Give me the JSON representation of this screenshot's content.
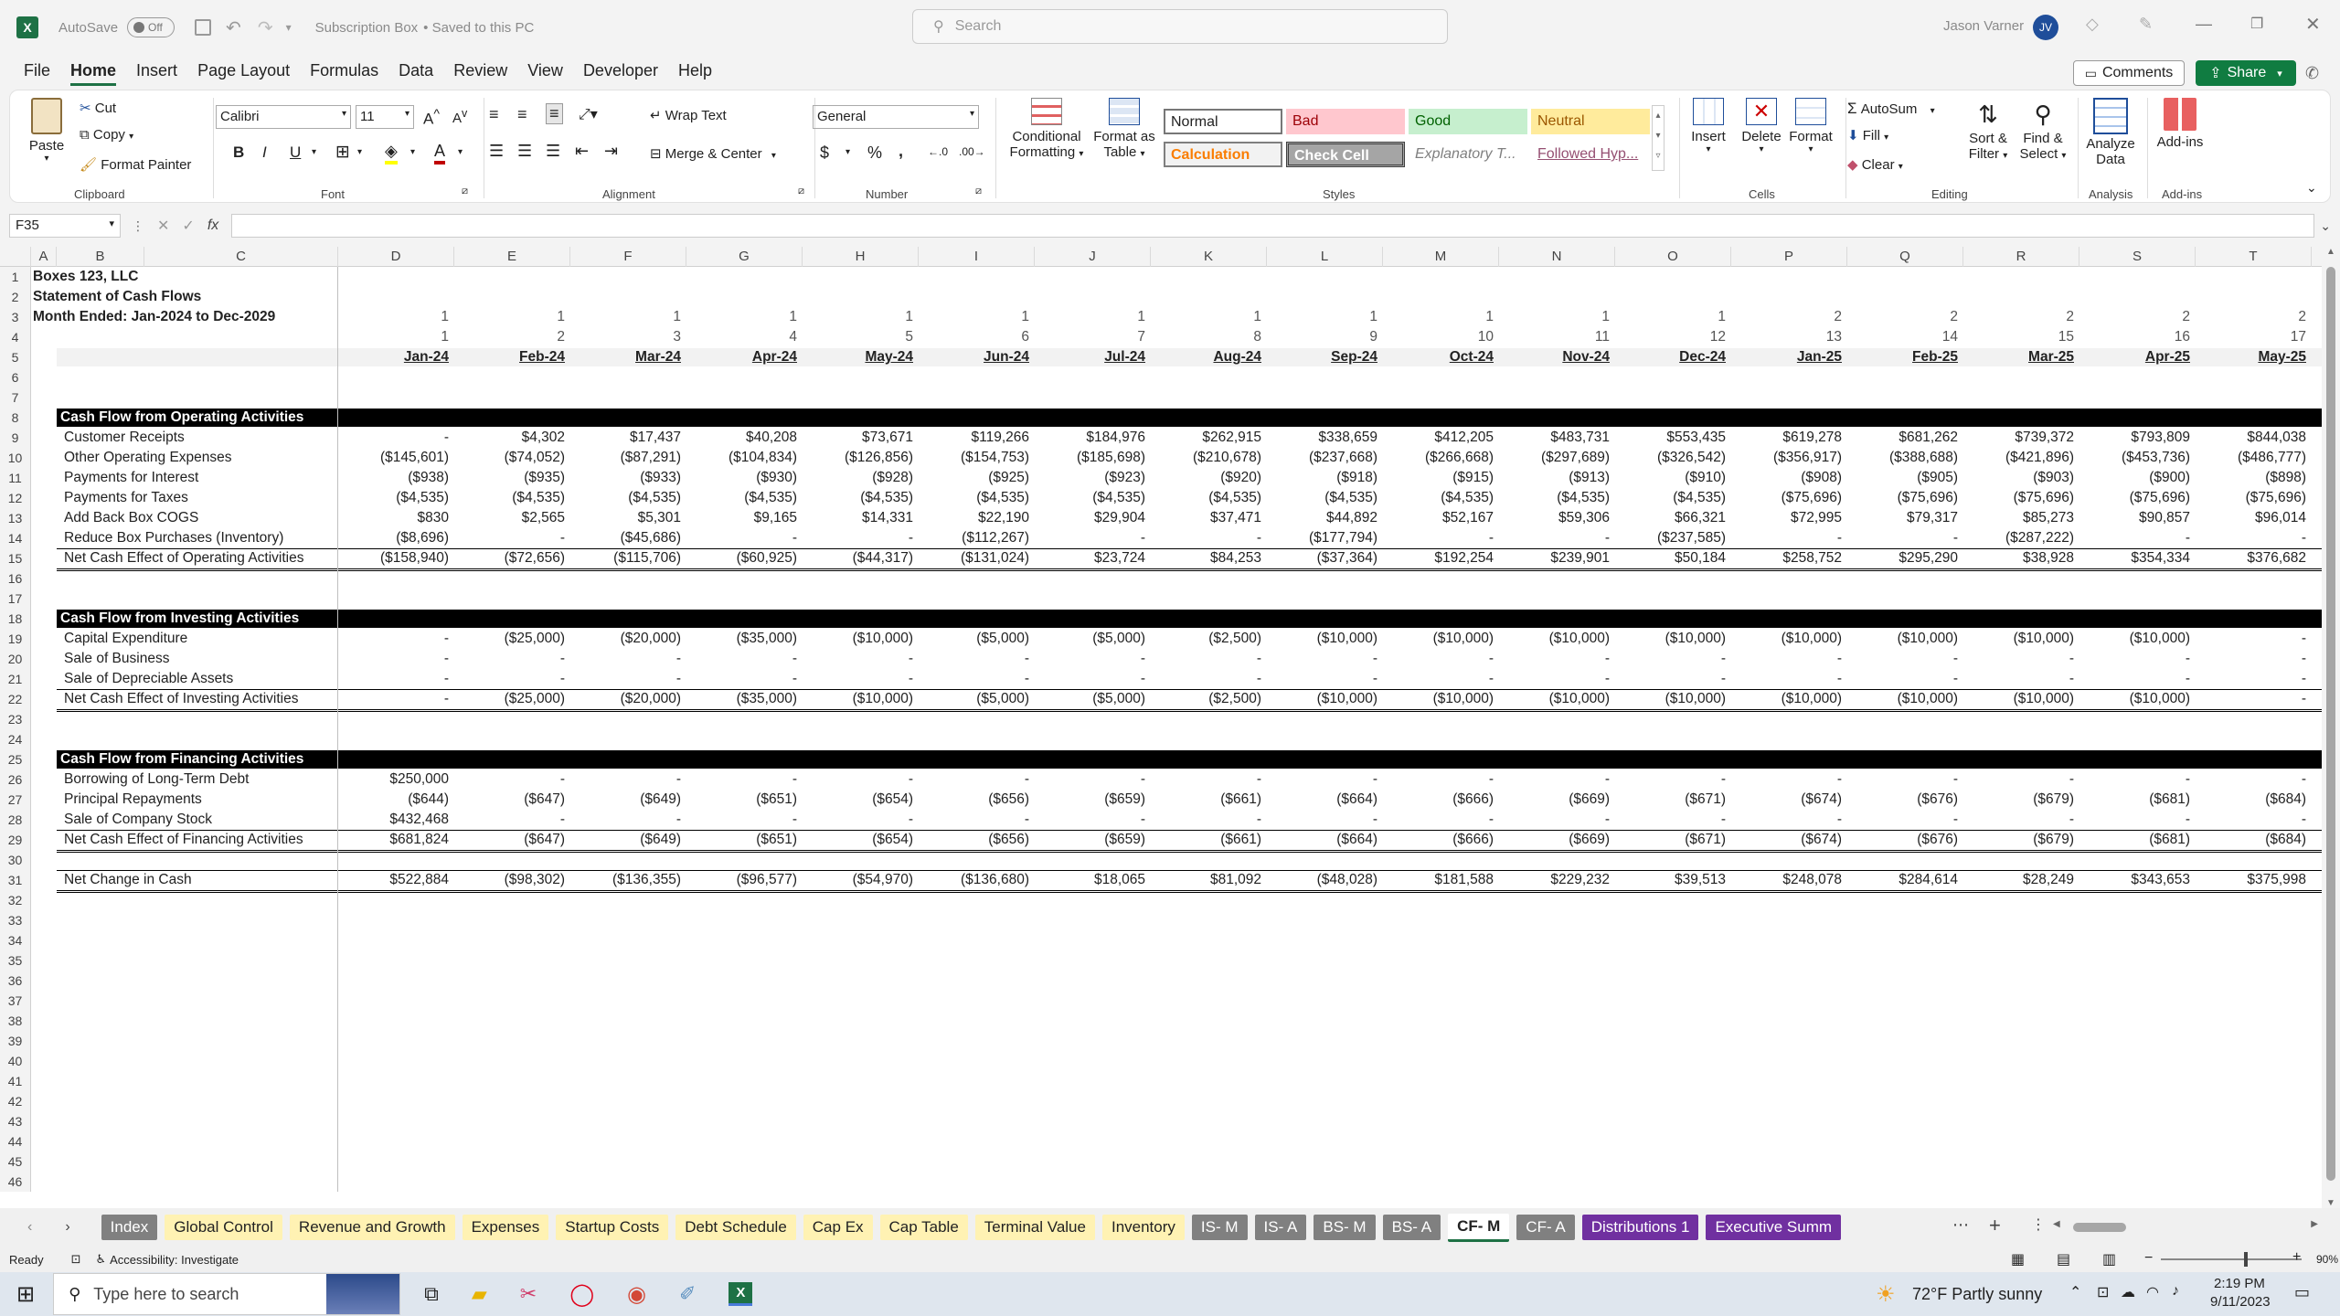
{
  "titlebar": {
    "autosave": "AutoSave",
    "toggle": "Off",
    "filename": "Subscription Box",
    "saved": "• Saved to this PC",
    "search_placeholder": "Search",
    "user": "Jason Varner",
    "initials": "JV"
  },
  "menu": [
    "File",
    "Home",
    "Insert",
    "Page Layout",
    "Formulas",
    "Data",
    "Review",
    "View",
    "Developer",
    "Help"
  ],
  "menu_right": {
    "comments": "Comments",
    "share": "Share"
  },
  "ribbon": {
    "clipboard": {
      "paste": "Paste",
      "cut": "Cut",
      "copy": "Copy",
      "format_painter": "Format Painter",
      "label": "Clipboard"
    },
    "font": {
      "name": "Calibri",
      "size": "11",
      "label": "Font"
    },
    "alignment": {
      "wrap": "Wrap Text",
      "merge": "Merge & Center",
      "label": "Alignment"
    },
    "number": {
      "format": "General",
      "label": "Number"
    },
    "styles": {
      "cond": "Conditional",
      "cond2": "Formatting",
      "fmt_table": "Format as",
      "fmt_table2": "Table",
      "normal": "Normal",
      "bad": "Bad",
      "good": "Good",
      "neutral": "Neutral",
      "calculation": "Calculation",
      "check": "Check Cell",
      "explanatory": "Explanatory T...",
      "followed": "Followed Hyp...",
      "label": "Styles"
    },
    "cells": {
      "insert": "Insert",
      "delete": "Delete",
      "format": "Format",
      "label": "Cells"
    },
    "editing": {
      "autosum": "AutoSum",
      "fill": "Fill",
      "clear": "Clear",
      "sort": "Sort &",
      "sort2": "Filter",
      "find": "Find &",
      "find2": "Select",
      "label": "Editing"
    },
    "analysis": {
      "analyze": "Analyze",
      "analyze2": "Data",
      "label": "Analysis"
    },
    "addins": {
      "addins": "Add-ins",
      "label": "Add-ins"
    }
  },
  "formula": {
    "namebox": "F35",
    "fx": "fx"
  },
  "columns": [
    "A",
    "B",
    "C",
    "D",
    "E",
    "F",
    "G",
    "H",
    "I",
    "J",
    "K",
    "L",
    "M",
    "N",
    "O",
    "P",
    "Q",
    "R",
    "S",
    "T"
  ],
  "header": {
    "r1": "Boxes 123, LLC",
    "r2": "Statement of Cash Flows",
    "r3": "Month Ended: Jan-2024 to Dec-2029"
  },
  "row3": [
    "1",
    "1",
    "1",
    "1",
    "1",
    "1",
    "1",
    "1",
    "1",
    "1",
    "1",
    "1",
    "2",
    "2",
    "2",
    "2",
    "2"
  ],
  "row4": [
    "1",
    "2",
    "3",
    "4",
    "5",
    "6",
    "7",
    "8",
    "9",
    "10",
    "11",
    "12",
    "13",
    "14",
    "15",
    "16",
    "17"
  ],
  "months": [
    "Jan-24",
    "Feb-24",
    "Mar-24",
    "Apr-24",
    "May-24",
    "Jun-24",
    "Jul-24",
    "Aug-24",
    "Sep-24",
    "Oct-24",
    "Nov-24",
    "Dec-24",
    "Jan-25",
    "Feb-25",
    "Mar-25",
    "Apr-25",
    "May-25"
  ],
  "sections": [
    {
      "row": 8,
      "title": "Cash Flow from Operating Activities"
    },
    {
      "row": 18,
      "title": "Cash Flow from Investing Activities"
    },
    {
      "row": 25,
      "title": "Cash Flow from Financing Activities"
    }
  ],
  "data_rows": [
    {
      "row": 9,
      "label": "Customer Receipts",
      "values": [
        "-",
        "$4,302",
        "$17,437",
        "$40,208",
        "$73,671",
        "$119,266",
        "$184,976",
        "$262,915",
        "$338,659",
        "$412,205",
        "$483,731",
        "$553,435",
        "$619,278",
        "$681,262",
        "$739,372",
        "$793,809",
        "$844,038"
      ]
    },
    {
      "row": 10,
      "label": "Other Operating Expenses",
      "values": [
        "($145,601)",
        "($74,052)",
        "($87,291)",
        "($104,834)",
        "($126,856)",
        "($154,753)",
        "($185,698)",
        "($210,678)",
        "($237,668)",
        "($266,668)",
        "($297,689)",
        "($326,542)",
        "($356,917)",
        "($388,688)",
        "($421,896)",
        "($453,736)",
        "($486,777)"
      ]
    },
    {
      "row": 11,
      "label": "Payments for Interest",
      "values": [
        "($938)",
        "($935)",
        "($933)",
        "($930)",
        "($928)",
        "($925)",
        "($923)",
        "($920)",
        "($918)",
        "($915)",
        "($913)",
        "($910)",
        "($908)",
        "($905)",
        "($903)",
        "($900)",
        "($898)"
      ]
    },
    {
      "row": 12,
      "label": "Payments for Taxes",
      "values": [
        "($4,535)",
        "($4,535)",
        "($4,535)",
        "($4,535)",
        "($4,535)",
        "($4,535)",
        "($4,535)",
        "($4,535)",
        "($4,535)",
        "($4,535)",
        "($4,535)",
        "($4,535)",
        "($75,696)",
        "($75,696)",
        "($75,696)",
        "($75,696)",
        "($75,696)"
      ]
    },
    {
      "row": 13,
      "label": "Add Back Box COGS",
      "values": [
        "$830",
        "$2,565",
        "$5,301",
        "$9,165",
        "$14,331",
        "$22,190",
        "$29,904",
        "$37,471",
        "$44,892",
        "$52,167",
        "$59,306",
        "$66,321",
        "$72,995",
        "$79,317",
        "$85,273",
        "$90,857",
        "$96,014"
      ]
    },
    {
      "row": 14,
      "label": "Reduce Box Purchases (Inventory)",
      "values": [
        "($8,696)",
        "-",
        "($45,686)",
        "-",
        "-",
        "($112,267)",
        "-",
        "-",
        "($177,794)",
        "-",
        "-",
        "($237,585)",
        "-",
        "-",
        "($287,222)",
        "-",
        "-"
      ]
    },
    {
      "row": 15,
      "label": "Net Cash Effect of Operating Activities",
      "total": true,
      "values": [
        "($158,940)",
        "($72,656)",
        "($115,706)",
        "($60,925)",
        "($44,317)",
        "($131,024)",
        "$23,724",
        "$84,253",
        "($37,364)",
        "$192,254",
        "$239,901",
        "$50,184",
        "$258,752",
        "$295,290",
        "$38,928",
        "$354,334",
        "$376,682"
      ]
    },
    {
      "row": 19,
      "label": "Capital Expenditure",
      "values": [
        "-",
        "($25,000)",
        "($20,000)",
        "($35,000)",
        "($10,000)",
        "($5,000)",
        "($5,000)",
        "($2,500)",
        "($10,000)",
        "($10,000)",
        "($10,000)",
        "($10,000)",
        "($10,000)",
        "($10,000)",
        "($10,000)",
        "($10,000)",
        "-"
      ]
    },
    {
      "row": 20,
      "label": "Sale of Business",
      "values": [
        "-",
        "-",
        "-",
        "-",
        "-",
        "-",
        "-",
        "-",
        "-",
        "-",
        "-",
        "-",
        "-",
        "-",
        "-",
        "-",
        "-"
      ]
    },
    {
      "row": 21,
      "label": "Sale of Depreciable Assets",
      "values": [
        "-",
        "-",
        "-",
        "-",
        "-",
        "-",
        "-",
        "-",
        "-",
        "-",
        "-",
        "-",
        "-",
        "-",
        "-",
        "-",
        "-"
      ]
    },
    {
      "row": 22,
      "label": "Net Cash Effect of Investing Activities",
      "total": true,
      "values": [
        "-",
        "($25,000)",
        "($20,000)",
        "($35,000)",
        "($10,000)",
        "($5,000)",
        "($5,000)",
        "($2,500)",
        "($10,000)",
        "($10,000)",
        "($10,000)",
        "($10,000)",
        "($10,000)",
        "($10,000)",
        "($10,000)",
        "($10,000)",
        "-"
      ]
    },
    {
      "row": 26,
      "label": "Borrowing of Long-Term Debt",
      "values": [
        "$250,000",
        "-",
        "-",
        "-",
        "-",
        "-",
        "-",
        "-",
        "-",
        "-",
        "-",
        "-",
        "-",
        "-",
        "-",
        "-",
        "-"
      ]
    },
    {
      "row": 27,
      "label": "Principal Repayments",
      "values": [
        "($644)",
        "($647)",
        "($649)",
        "($651)",
        "($654)",
        "($656)",
        "($659)",
        "($661)",
        "($664)",
        "($666)",
        "($669)",
        "($671)",
        "($674)",
        "($676)",
        "($679)",
        "($681)",
        "($684)"
      ]
    },
    {
      "row": 28,
      "label": "Sale of Company Stock",
      "values": [
        "$432,468",
        "-",
        "-",
        "-",
        "-",
        "-",
        "-",
        "-",
        "-",
        "-",
        "-",
        "-",
        "-",
        "-",
        "-",
        "-",
        "-"
      ]
    },
    {
      "row": 29,
      "label": "Net Cash Effect of Financing Activities",
      "total": true,
      "values": [
        "$681,824",
        "($647)",
        "($649)",
        "($651)",
        "($654)",
        "($656)",
        "($659)",
        "($661)",
        "($664)",
        "($666)",
        "($669)",
        "($671)",
        "($674)",
        "($676)",
        "($679)",
        "($681)",
        "($684)"
      ]
    },
    {
      "row": 31,
      "label": "Net Change in Cash",
      "total": true,
      "values": [
        "$522,884",
        "($98,302)",
        "($136,355)",
        "($96,577)",
        "($54,970)",
        "($136,680)",
        "$18,065",
        "$81,092",
        "($48,028)",
        "$181,588",
        "$229,232",
        "$39,513",
        "$248,078",
        "$284,614",
        "$28,249",
        "$343,653",
        "$375,998"
      ]
    }
  ],
  "sheet_tabs": [
    {
      "name": "Index",
      "bg": "#808080",
      "fg": "#ffffff"
    },
    {
      "name": "Global Control",
      "bg": "#fff2b3",
      "fg": "#222222"
    },
    {
      "name": "Revenue and Growth",
      "bg": "#fff2b3",
      "fg": "#222222"
    },
    {
      "name": "Expenses",
      "bg": "#fff2b3",
      "fg": "#222222"
    },
    {
      "name": "Startup Costs",
      "bg": "#fff2b3",
      "fg": "#222222"
    },
    {
      "name": "Debt Schedule",
      "bg": "#fff2b3",
      "fg": "#222222"
    },
    {
      "name": "Cap Ex",
      "bg": "#fff2b3",
      "fg": "#222222"
    },
    {
      "name": "Cap Table",
      "bg": "#fff2b3",
      "fg": "#222222"
    },
    {
      "name": "Terminal Value",
      "bg": "#fff2b3",
      "fg": "#222222"
    },
    {
      "name": "Inventory",
      "bg": "#fff2b3",
      "fg": "#222222"
    },
    {
      "name": "IS- M",
      "bg": "#808080",
      "fg": "#ffffff"
    },
    {
      "name": "IS- A",
      "bg": "#808080",
      "fg": "#ffffff"
    },
    {
      "name": "BS- M",
      "bg": "#808080",
      "fg": "#ffffff"
    },
    {
      "name": "BS- A",
      "bg": "#808080",
      "fg": "#ffffff"
    },
    {
      "name": "CF- M",
      "bg": "#ffffff",
      "fg": "#222222",
      "active": true
    },
    {
      "name": "CF- A",
      "bg": "#808080",
      "fg": "#ffffff"
    },
    {
      "name": "Distributions 1",
      "bg": "#7030a0",
      "fg": "#ffffff"
    },
    {
      "name": "Executive Summ",
      "bg": "#7030a0",
      "fg": "#ffffff"
    }
  ],
  "status": {
    "ready": "Ready",
    "accessibility": "Accessibility: Investigate",
    "zoom": "90%"
  },
  "taskbar": {
    "search": "Type here to search",
    "weather": "72°F  Partly sunny",
    "time": "2:19 PM",
    "date": "9/11/2023"
  },
  "colors": {
    "excel_green": "#1e7145",
    "share_green": "#107c41",
    "band": "#000000"
  }
}
